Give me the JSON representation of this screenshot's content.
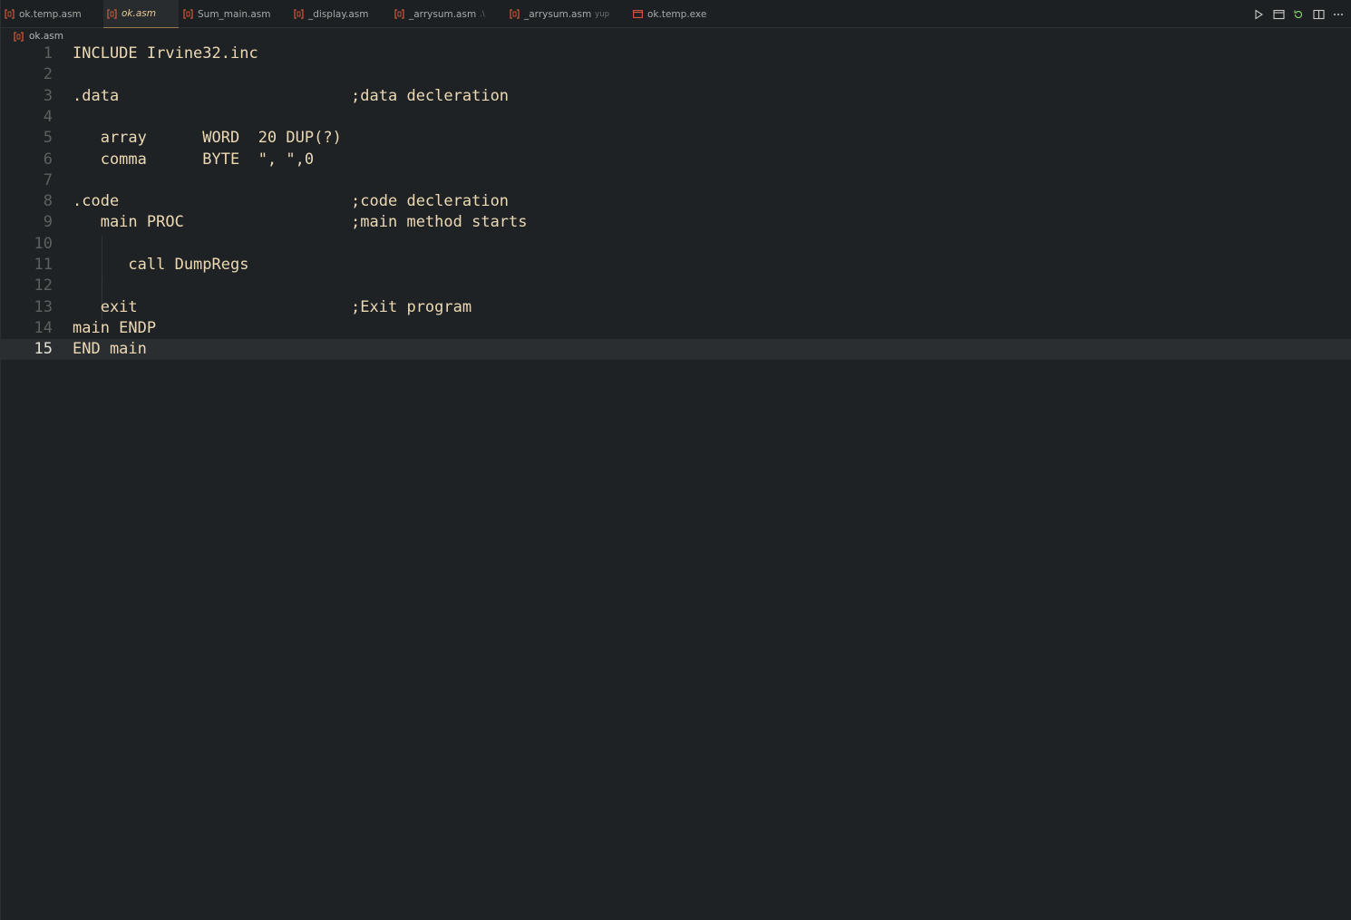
{
  "tabs": [
    {
      "label": "ok.temp.asm",
      "suffix": "",
      "icon": "asm-file-icon",
      "active": false
    },
    {
      "label": "ok.asm",
      "suffix": "",
      "icon": "asm-file-icon",
      "active": true
    },
    {
      "label": "Sum_main.asm",
      "suffix": "",
      "icon": "asm-file-icon",
      "active": false
    },
    {
      "label": "_display.asm",
      "suffix": "",
      "icon": "asm-file-icon",
      "active": false
    },
    {
      "label": "_arrysum.asm",
      "suffix": ".\\",
      "icon": "asm-file-icon",
      "active": false
    },
    {
      "label": "_arrysum.asm",
      "suffix": "yup",
      "icon": "asm-file-icon",
      "active": false
    },
    {
      "label": "ok.temp.exe",
      "suffix": "",
      "icon": "exe-file-icon",
      "active": false
    }
  ],
  "actions": [
    "run-icon",
    "open-preview-icon",
    "revert-icon",
    "split-editor-icon",
    "more-actions-icon"
  ],
  "breadcrumb": {
    "file": "ok.asm"
  },
  "editor": {
    "current_line": 15,
    "lines": [
      {
        "num": "1",
        "text": "INCLUDE Irvine32.inc"
      },
      {
        "num": "2",
        "text": ""
      },
      {
        "num": "3",
        "text": ".data                         ;data decleration"
      },
      {
        "num": "4",
        "text": ""
      },
      {
        "num": "5",
        "text": "   array      WORD  20 DUP(?)"
      },
      {
        "num": "6",
        "text": "   comma      BYTE  \", \",0"
      },
      {
        "num": "7",
        "text": ""
      },
      {
        "num": "8",
        "text": ".code                         ;code decleration"
      },
      {
        "num": "9",
        "text": "   main PROC                  ;main method starts"
      },
      {
        "num": "10",
        "text": ""
      },
      {
        "num": "11",
        "text": "      call DumpRegs"
      },
      {
        "num": "12",
        "text": ""
      },
      {
        "num": "13",
        "text": "   exit                       ;Exit program"
      },
      {
        "num": "14",
        "text": "main ENDP"
      },
      {
        "num": "15",
        "text": "END main"
      }
    ]
  },
  "colors": {
    "background": "#1f2224",
    "code_text": "#ecd9b4",
    "line_number": "#5c605f",
    "asm_icon": "#d05a3c",
    "active_tab_text": "#e8c896"
  }
}
